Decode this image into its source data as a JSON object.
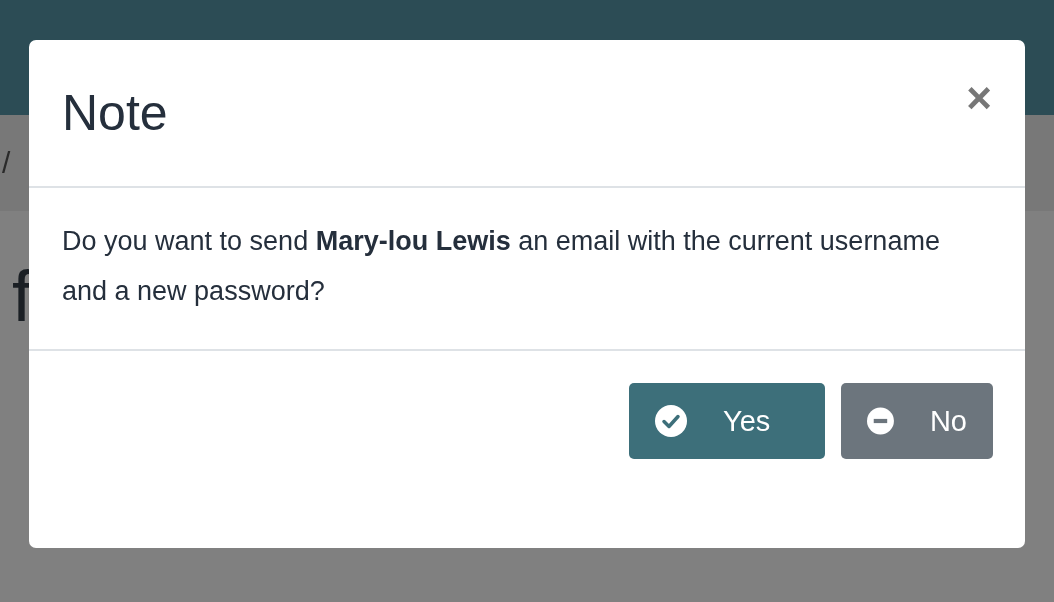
{
  "background": {
    "breadcrumb": "/",
    "heading": "f"
  },
  "dialog": {
    "title": "Note",
    "close": "×",
    "message": "Do you want to send **Mary-lou Lewis** an email with the current username and a new password?",
    "buttons": [
      {
        "label": "Yes",
        "kind": "confirm"
      },
      {
        "label": "No",
        "kind": "cancel"
      }
    ]
  }
}
